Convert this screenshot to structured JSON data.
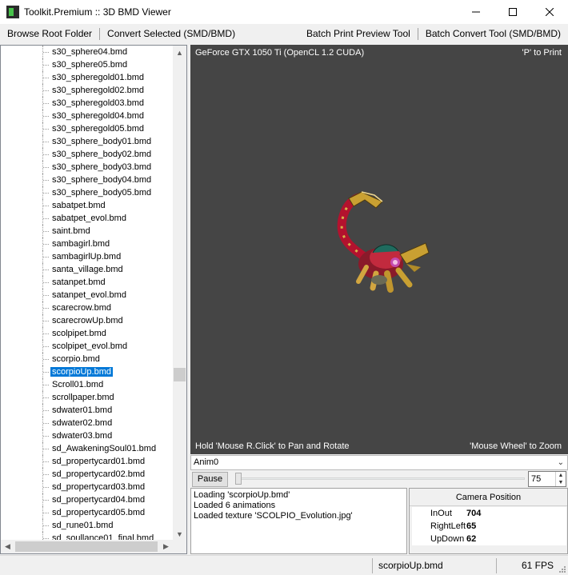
{
  "window": {
    "title": "Toolkit.Premium :: 3D BMD Viewer",
    "icons": {
      "app": "app-icon",
      "minimize": "minimize-icon",
      "maximize": "maximize-icon",
      "close": "close-icon"
    }
  },
  "menu": {
    "browse_root": "Browse Root Folder",
    "convert_selected": "Convert Selected (SMD/BMD)",
    "batch_print": "Batch Print Preview Tool",
    "batch_convert": "Batch Convert Tool (SMD/BMD)"
  },
  "tree": {
    "items": [
      "s30_sphere04.bmd",
      "s30_sphere05.bmd",
      "s30_spheregold01.bmd",
      "s30_spheregold02.bmd",
      "s30_spheregold03.bmd",
      "s30_spheregold04.bmd",
      "s30_spheregold05.bmd",
      "s30_sphere_body01.bmd",
      "s30_sphere_body02.bmd",
      "s30_sphere_body03.bmd",
      "s30_sphere_body04.bmd",
      "s30_sphere_body05.bmd",
      "sabatpet.bmd",
      "sabatpet_evol.bmd",
      "saint.bmd",
      "sambagirl.bmd",
      "sambagirlUp.bmd",
      "santa_village.bmd",
      "satanpet.bmd",
      "satanpet_evol.bmd",
      "scarecrow.bmd",
      "scarecrowUp.bmd",
      "scolpipet.bmd",
      "scolpipet_evol.bmd",
      "scorpio.bmd",
      "scorpioUp.bmd",
      "Scroll01.bmd",
      "scrollpaper.bmd",
      "sdwater01.bmd",
      "sdwater02.bmd",
      "sdwater03.bmd",
      "sd_AwakeningSoul01.bmd",
      "sd_propertycard01.bmd",
      "sd_propertycard02.bmd",
      "sd_propertycard03.bmd",
      "sd_propertycard04.bmd",
      "sd_propertycard05.bmd",
      "sd_rune01.bmd",
      "sd_soullance01_final.bmd"
    ],
    "selected": "scorpioUp.bmd",
    "scroll_position": 0.68
  },
  "viewport": {
    "gpu": "GeForce GTX 1050 Ti (OpenCL 1.2 CUDA)",
    "print_hint": "'P' to Print",
    "pan_hint": "Hold 'Mouse R.Click' to Pan and Rotate",
    "zoom_hint": "'Mouse Wheel' to Zoom",
    "background": "#454545"
  },
  "animation": {
    "selected": "Anim0",
    "pause_label": "Pause",
    "speed": "75",
    "progress": 0.0
  },
  "log": {
    "lines": [
      "Loading 'scorpioUp.bmd'",
      "Loaded 6 animations",
      "Loaded texture 'SCOLPIO_Evolution.jpg'"
    ]
  },
  "camera": {
    "title": "Camera Position",
    "rows": [
      {
        "label": "InOut",
        "value": "704"
      },
      {
        "label": "RightLeft",
        "value": "65"
      },
      {
        "label": "UpDown",
        "value": "62"
      }
    ]
  },
  "status": {
    "file": "scorpioUp.bmd",
    "fps": "61 FPS"
  },
  "colors": {
    "selection": "#0078d7",
    "viewport_bg": "#454545"
  }
}
